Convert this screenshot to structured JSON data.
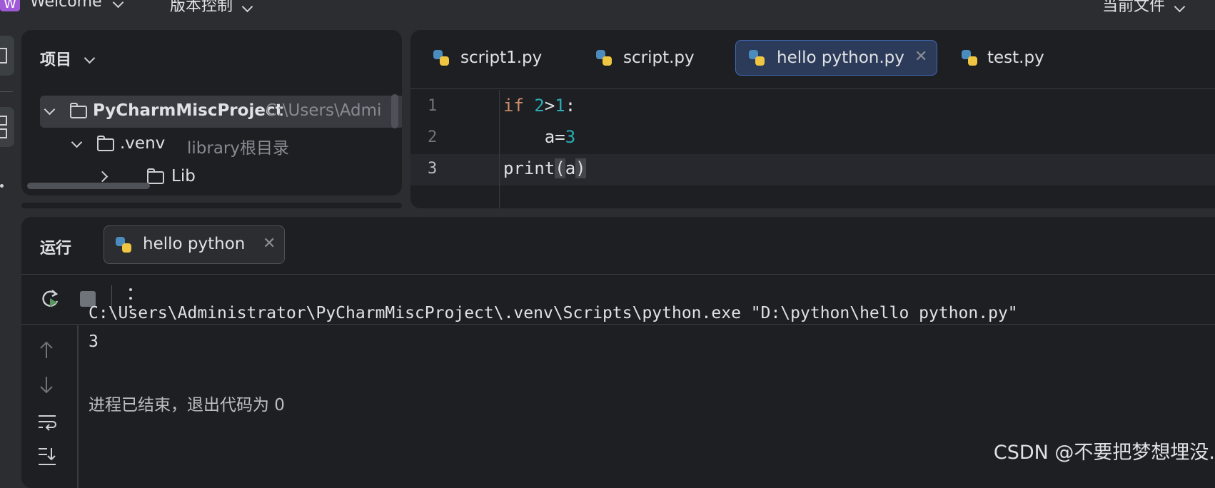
{
  "topbar": {
    "app_letter": "W",
    "project": "Welcome",
    "vcs": "版本控制",
    "run_config": "当前文件"
  },
  "project_panel": {
    "title": "项目",
    "tree": [
      {
        "name": "PyCharmMiscProject",
        "hint": "C:\\Users\\Admi"
      },
      {
        "name": ".venv",
        "hint": "library根目录"
      },
      {
        "name": "Lib",
        "hint": ""
      }
    ]
  },
  "editor": {
    "tabs": [
      {
        "label": "script1.py",
        "active": false
      },
      {
        "label": "script.py",
        "active": false
      },
      {
        "label": "hello python.py",
        "active": true
      },
      {
        "label": "test.py",
        "active": false
      }
    ],
    "line_numbers": [
      "1",
      "2",
      "3"
    ],
    "code": {
      "l1_kw": "if",
      "l1_a": "2",
      "l1_op": ">",
      "l1_b": "1",
      "l1_colon": ":",
      "l2_var": "a=",
      "l2_val": "3",
      "l3_fn": "print",
      "l3_open": "(",
      "l3_arg": "a",
      "l3_close": ")"
    }
  },
  "run_panel": {
    "title": "运行",
    "tab_label": "hello python",
    "output": [
      "C:\\Users\\Administrator\\PyCharmMiscProject\\.venv\\Scripts\\python.exe \"D:\\python\\hello python.py\"",
      "3",
      "",
      "进程已结束，退出代码为 0"
    ]
  },
  "watermark": "CSDN @不要把梦想埋没.",
  "colors": {
    "keyword": "#cf8e6d",
    "number": "#2aacb8",
    "active_tab": "#2c3b59",
    "accent": "#3f6ab3"
  },
  "icons": [
    "python-file-icon",
    "folder-icon",
    "rerun-icon",
    "stop-icon",
    "more-icon",
    "up-arrow-icon",
    "down-arrow-icon",
    "soft-wrap-icon",
    "scroll-to-end-icon"
  ]
}
